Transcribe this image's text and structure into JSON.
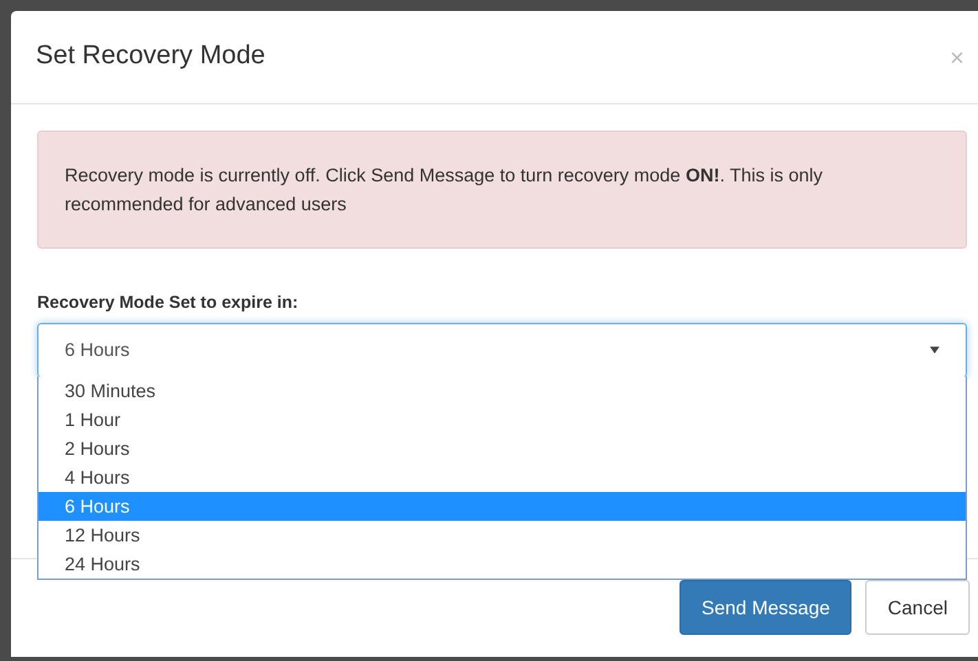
{
  "modal": {
    "title": "Set Recovery Mode",
    "close": "×"
  },
  "alert": "Recovery mode is currently off. Click Send Message to turn recovery mode **ON!**. This is only recommended for advanced users",
  "field": {
    "label": "Recovery Mode Set to expire in:",
    "value": "6 Hours",
    "expanded": true,
    "options": [
      {
        "label": "30 Minutes",
        "selected": false
      },
      {
        "label": "1 Hour",
        "selected": false
      },
      {
        "label": "2 Hours",
        "selected": false
      },
      {
        "label": "4 Hours",
        "selected": false
      },
      {
        "label": "6 Hours",
        "selected": true
      },
      {
        "label": "12 Hours",
        "selected": false
      },
      {
        "label": "24 Hours",
        "selected": false
      }
    ]
  },
  "buttons": [
    {
      "label": "Send Message",
      "kind": "primary"
    },
    {
      "label": "Cancel",
      "kind": "default"
    }
  ]
}
